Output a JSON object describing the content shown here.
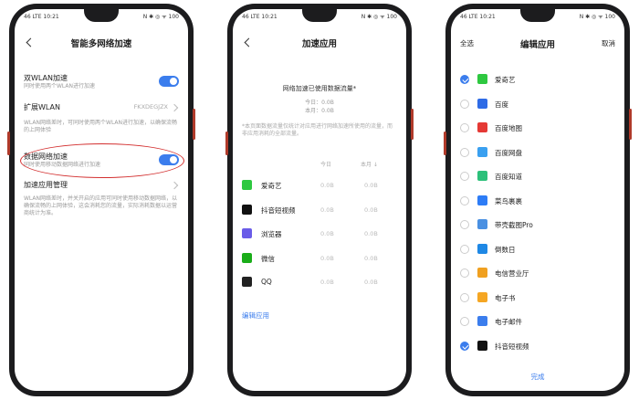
{
  "status": {
    "left": "46 LTE 10:21",
    "right": "N ✱ ◎ ᯤ 100"
  },
  "screen1": {
    "title": "智能多网络加速",
    "dual_wlan": {
      "label": "双WLAN加速",
      "sub": "同时使用两个WLAN进行加速"
    },
    "ext_wlan": {
      "label": "扩展WLAN",
      "value": "FKXDEGJZX"
    },
    "wlan_note": "WLAN网络差时，可同时使用两个WLAN进行加速，以确保流畅的上网体验",
    "data_accel": {
      "label": "数据网络加速",
      "sub": "同时使用移动数据网络进行加速"
    },
    "manage": {
      "label": "加速应用管理"
    },
    "data_note": "WLAN网络差时，并关开启的应用可同时使用移动数据网络，以确保流畅的上网体验，这会消耗您的流量，实际消耗数据以运营商统计为准。"
  },
  "screen2": {
    "title": "加速应用",
    "summary": "网络加速已使用数据流量*",
    "today": "今日：0.0B",
    "month": "本月：0.0B",
    "note": "*本页面数据流量仅统计对应用进行网络加速所使用的流量，而非应用消耗的全部流量。",
    "col_today": "今日",
    "col_month": "本月 ↓",
    "apps": [
      {
        "name": "爱奇艺",
        "today": "0.0B",
        "month": "0.0B",
        "color": "#2ec840"
      },
      {
        "name": "抖音短视频",
        "today": "0.0B",
        "month": "0.0B",
        "color": "#111111"
      },
      {
        "name": "浏览器",
        "today": "0.0B",
        "month": "0.0B",
        "color": "#6a5ce8"
      },
      {
        "name": "微信",
        "today": "0.0B",
        "month": "0.0B",
        "color": "#1aad19"
      },
      {
        "name": "QQ",
        "today": "0.0B",
        "month": "0.0B",
        "color": "#222222"
      }
    ],
    "edit": "编辑应用"
  },
  "screen3": {
    "select_all": "全选",
    "title": "编辑应用",
    "cancel": "取消",
    "done": "完成",
    "apps": [
      {
        "name": "爱奇艺",
        "checked": true,
        "color": "#2ec840"
      },
      {
        "name": "百度",
        "checked": false,
        "color": "#2e6be6"
      },
      {
        "name": "百度地图",
        "checked": false,
        "color": "#e53935"
      },
      {
        "name": "百度网盘",
        "checked": false,
        "color": "#3aa0f0"
      },
      {
        "name": "百度知道",
        "checked": false,
        "color": "#2cc07a"
      },
      {
        "name": "菜鸟裹裹",
        "checked": false,
        "color": "#2d7cf6"
      },
      {
        "name": "带壳截图Pro",
        "checked": false,
        "color": "#4a90e2"
      },
      {
        "name": "倒数日",
        "checked": false,
        "color": "#1e88e5"
      },
      {
        "name": "电信营业厅",
        "checked": false,
        "color": "#f0a020"
      },
      {
        "name": "电子书",
        "checked": false,
        "color": "#f5a623"
      },
      {
        "name": "电子邮件",
        "checked": false,
        "color": "#3b7ded"
      },
      {
        "name": "抖音短视频",
        "checked": true,
        "color": "#111111"
      }
    ]
  }
}
